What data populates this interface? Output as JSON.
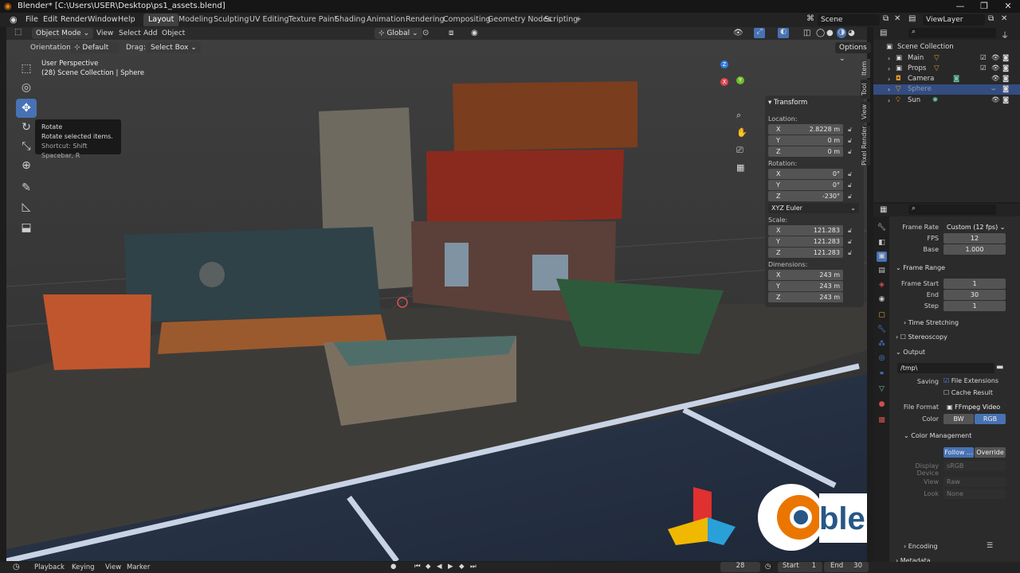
{
  "window": {
    "title": "Blender* [C:\\Users\\USER\\Desktop\\ps1_assets.blend]",
    "minimize": "—",
    "maximize": "❐",
    "close": "✕"
  },
  "menus": [
    "File",
    "Edit",
    "Render",
    "Window",
    "Help"
  ],
  "workspaces": [
    "Layout",
    "Modeling",
    "Sculpting",
    "UV Editing",
    "Texture Paint",
    "Shading",
    "Animation",
    "Rendering",
    "Compositing",
    "Geometry Nodes",
    "Scripting"
  ],
  "active_workspace": "Layout",
  "add_workspace": "+",
  "scene_name": "Scene",
  "view_layer": "ViewLayer",
  "viewport_header": {
    "mode": "Object Mode",
    "items": [
      "View",
      "Select",
      "Add",
      "Object"
    ],
    "transform_orientation": "Global",
    "options": "Options"
  },
  "tool_settings": {
    "orientation_label": "Orientation:",
    "orientation_value": "Default",
    "drag_label": "Drag:",
    "drag_value": "Select Box"
  },
  "viewport_info": {
    "perspective": "User Perspective",
    "context": "(28) Scene Collection | Sphere"
  },
  "tooltip": {
    "title": "Rotate",
    "description": "Rotate selected items.",
    "shortcut": "Shortcut: Shift Spacebar, R"
  },
  "gizmo_axes": {
    "x": "X",
    "y": "Y",
    "z": "Z"
  },
  "sidebar_tabs": [
    "Item",
    "Tool",
    "View",
    "Pixel Render"
  ],
  "transform_panel": {
    "title": "Transform",
    "location_label": "Location:",
    "location": [
      {
        "axis": "X",
        "value": "2.8228 m"
      },
      {
        "axis": "Y",
        "value": "0 m"
      },
      {
        "axis": "Z",
        "value": "0 m"
      }
    ],
    "rotation_label": "Rotation:",
    "rotation": [
      {
        "axis": "X",
        "value": "0°"
      },
      {
        "axis": "Y",
        "value": "0°"
      },
      {
        "axis": "Z",
        "value": "-230°"
      }
    ],
    "rotation_mode": "XYZ Euler",
    "scale_label": "Scale:",
    "scale": [
      {
        "axis": "X",
        "value": "121.283"
      },
      {
        "axis": "Y",
        "value": "121.283"
      },
      {
        "axis": "Z",
        "value": "121.283"
      }
    ],
    "dimensions_label": "Dimensions:",
    "dimensions": [
      {
        "axis": "X",
        "value": "243 m"
      },
      {
        "axis": "Y",
        "value": "243 m"
      },
      {
        "axis": "Z",
        "value": "243 m"
      }
    ]
  },
  "outliner": {
    "root": "Scene Collection",
    "items": [
      {
        "name": "Main",
        "selected": false
      },
      {
        "name": "Props",
        "selected": false
      },
      {
        "name": "Camera",
        "selected": false
      },
      {
        "name": "Sphere",
        "selected": true
      },
      {
        "name": "Sun",
        "selected": false
      }
    ]
  },
  "properties": {
    "frame_rate_label": "Frame Rate",
    "frame_rate_value": "Custom (12 fps)",
    "fps_label": "FPS",
    "fps_value": "12",
    "base_label": "Base",
    "base_value": "1.000",
    "frame_range_title": "Frame Range",
    "frame_start_label": "Frame Start",
    "frame_start_value": "1",
    "end_label": "End",
    "end_value": "30",
    "step_label": "Step",
    "step_value": "1",
    "time_stretching": "Time Stretching",
    "stereoscopy": "Stereoscopy",
    "output_title": "Output",
    "output_path": "/tmp\\",
    "saving_label": "Saving",
    "file_extensions": "File Extensions",
    "cache_result": "Cache Result",
    "file_format_label": "File Format",
    "file_format_value": "FFmpeg Video",
    "color_label": "Color",
    "color_bw": "BW",
    "color_rgb": "RGB",
    "color_management_title": "Color Management",
    "follow_scene": "Follow ...",
    "override": "Override",
    "display_device_label": "Display Device",
    "display_device_value": "sRGB",
    "view_label": "View",
    "view_value": "Raw",
    "look_label": "Look",
    "look_value": "None",
    "encoding": "Encoding",
    "metadata": "Metadata"
  },
  "timeline": {
    "items": [
      "Playback",
      "Keying",
      "View",
      "Marker"
    ],
    "current_frame": "28",
    "start_label": "Start",
    "start_value": "1",
    "end_label": "End",
    "end_value": "30"
  },
  "logo_text": "blender",
  "colors": {
    "accent": "#4772b3",
    "selected_row": "#334d80",
    "blender_orange": "#ea7600",
    "blender_blue": "#265787"
  }
}
